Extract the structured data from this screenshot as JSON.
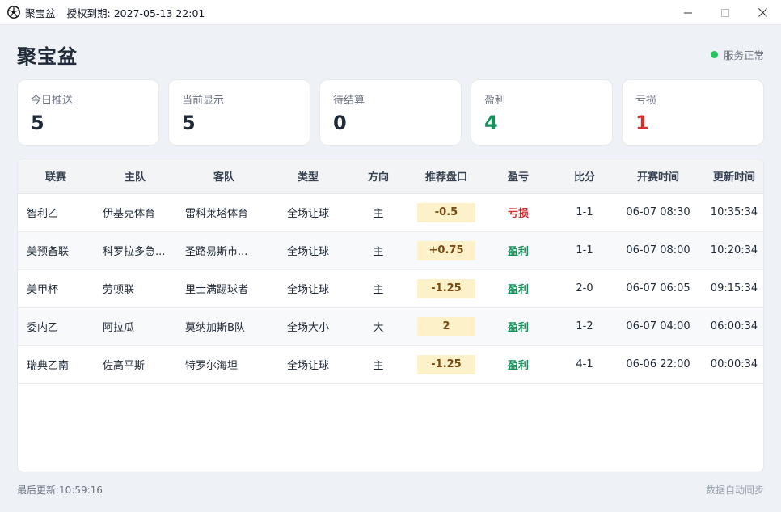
{
  "window": {
    "app_name": "聚宝盆",
    "license_label": "授权到期:",
    "license_expiry": "2027-05-13 22:01",
    "icon": "soccer-ball-icon"
  },
  "header": {
    "title": "聚宝盆",
    "status_text": "服务正常",
    "status_color": "#22c55e"
  },
  "stats": [
    {
      "label": "今日推送",
      "value": "5",
      "tone": "default"
    },
    {
      "label": "当前显示",
      "value": "5",
      "tone": "default"
    },
    {
      "label": "待结算",
      "value": "0",
      "tone": "default"
    },
    {
      "label": "盈利",
      "value": "4",
      "tone": "green"
    },
    {
      "label": "亏损",
      "value": "1",
      "tone": "red"
    }
  ],
  "table": {
    "columns": [
      "联赛",
      "主队",
      "客队",
      "类型",
      "方向",
      "推荐盘口",
      "盈亏",
      "比分",
      "开赛时间",
      "更新时间"
    ],
    "rows": [
      {
        "league": "智利乙",
        "home": "伊基克体育",
        "away": "雷科莱塔体育",
        "type": "全场让球",
        "direction": "主",
        "line": "-0.5",
        "result": "亏损",
        "result_tone": "loss",
        "score": "1-1",
        "kickoff": "06-07 08:30",
        "updated": "10:35:34"
      },
      {
        "league": "美预备联",
        "home": "科罗拉多急...",
        "away": "圣路易斯市...",
        "type": "全场让球",
        "direction": "主",
        "line": "+0.75",
        "result": "盈利",
        "result_tone": "profit",
        "score": "1-1",
        "kickoff": "06-07 08:00",
        "updated": "10:20:34"
      },
      {
        "league": "美甲杯",
        "home": "劳顿联",
        "away": "里士满踢球者",
        "type": "全场让球",
        "direction": "主",
        "line": "-1.25",
        "result": "盈利",
        "result_tone": "profit",
        "score": "2-0",
        "kickoff": "06-07 06:05",
        "updated": "09:15:34"
      },
      {
        "league": "委内乙",
        "home": "阿拉瓜",
        "away": "莫纳加斯B队",
        "type": "全场大小",
        "direction": "大",
        "line": "2",
        "result": "盈利",
        "result_tone": "profit",
        "score": "1-2",
        "kickoff": "06-07 04:00",
        "updated": "06:00:34"
      },
      {
        "league": "瑞典乙南",
        "home": "佐高平斯",
        "away": "特罗尔海坦",
        "type": "全场让球",
        "direction": "主",
        "line": "-1.25",
        "result": "盈利",
        "result_tone": "profit",
        "score": "4-1",
        "kickoff": "06-06 22:00",
        "updated": "00:00:34"
      }
    ]
  },
  "footer": {
    "last_update_label": "最后更新:",
    "last_update_time": "10:59:16",
    "sync_text": "数据自动同步"
  },
  "colors": {
    "profit": "#15915a",
    "loss": "#d32f2f",
    "line_bg": "#fdf1c9"
  }
}
